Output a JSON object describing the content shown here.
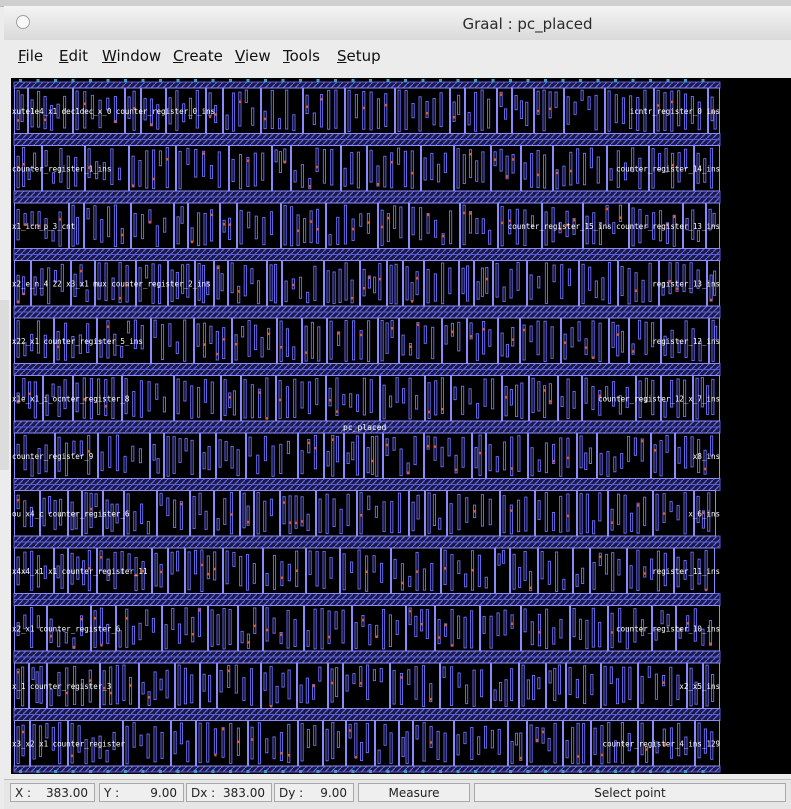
{
  "window": {
    "title": "Graal : pc_placed"
  },
  "menu": {
    "items": [
      {
        "label": "File",
        "accel": "F",
        "rest": "ile"
      },
      {
        "label": "Edit",
        "accel": "E",
        "rest": "dit"
      },
      {
        "label": "Window",
        "accel": "W",
        "rest": "indow"
      },
      {
        "label": "Create",
        "accel": "C",
        "rest": "reate"
      },
      {
        "label": "View",
        "accel": "V",
        "rest": "iew"
      },
      {
        "label": "Tools",
        "accel": "T",
        "rest": "ools"
      },
      {
        "label": "Setup",
        "accel": "S",
        "rest": "etup"
      }
    ]
  },
  "layout_view": {
    "cell_name": "pc_placed",
    "colors": {
      "background": "#000000",
      "rail": "#5a5ad8",
      "instance_outline": "#8a8aff",
      "metal": "#7070ff",
      "via": "#e05a2a",
      "text": "#ffffff"
    },
    "rows": [
      {
        "label": "xute1e4_x1 dec1dec_x_0 counter_register_0_ins",
        "right_label": "icntr_register_0 ins"
      },
      {
        "label": "counter_register_1_ins",
        "right_label": "counter_register_14_ins"
      },
      {
        "label": "x1_icn_p_3_cnt",
        "right_label": "counter_register_15_ins counter_register_13_ins"
      },
      {
        "label": "x2_e_n_4 22 x3_x1 mux counter_register_2_ins",
        "right_label": "register_13_ins"
      },
      {
        "label": "x22_x1 counter_register_5_ins",
        "right_label": "register_12_ins"
      },
      {
        "label": "x1e_x1_i_ocnter_register_8",
        "right_label": "counter_register_12_x_7_ins"
      },
      {
        "label": "counter_register_9",
        "right_label": "x8_ins"
      },
      {
        "label": "ou x4_c counter_register_6",
        "right_label": "x_6_ins"
      },
      {
        "label": "x4x4_x1 x1 counter_register_11",
        "right_label": "register_11_ins"
      },
      {
        "label": "x2_x1 counter_register_6",
        "right_label": "counter_register_10_ins"
      },
      {
        "label": "x_1 counter_register_3",
        "right_label": "x2_x5_ins"
      },
      {
        "label": "x3_x2 x1 counter_register",
        "right_label": "counter_register_4_ins_129"
      }
    ]
  },
  "status": {
    "x_label": "X :",
    "x_value": "383.00",
    "y_label": "Y :",
    "y_value": "9.00",
    "dx_label": "Dx :",
    "dx_value": "383.00",
    "dy_label": "Dy :",
    "dy_value": "9.00",
    "mode": "Measure",
    "action": "Select point"
  }
}
